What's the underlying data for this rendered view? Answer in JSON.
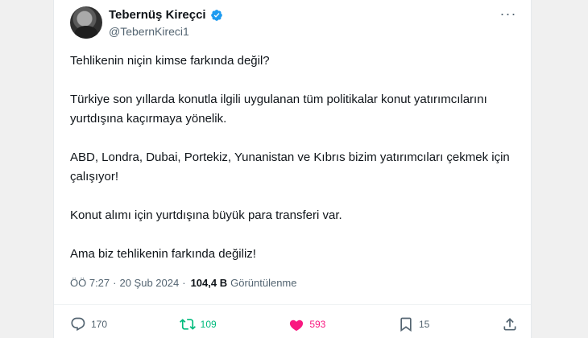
{
  "author": {
    "name": "Tebernüş Kireçci",
    "handle": "@TebernKireci1",
    "verified_color": "#1d9bf0"
  },
  "tweet": {
    "paragraphs": [
      "Tehlikenin niçin kimse farkında değil?",
      "Türkiye son yıllarda konutla ilgili uygulanan tüm politikalar konut yatırımcılarını yurtdışına kaçırmaya yönelik.",
      "ABD, Londra, Dubai, Portekiz, Yunanistan ve Kıbrıs bizim yatırımcıları çekmek için çalışıyor!",
      "Konut alımı için yurtdışına büyük para transferi var.",
      "Ama biz tehlikenin farkında değiliz!"
    ]
  },
  "meta": {
    "time": "ÖÖ 7:27",
    "separator": "·",
    "date": "20 Şub 2024",
    "views_count": "104,4 B",
    "views_label": "Görüntülenme"
  },
  "actions": {
    "replies": "170",
    "retweets": "109",
    "likes": "593",
    "bookmarks": "15"
  },
  "colors": {
    "retweet": "#00ba7c",
    "like": "#f91880",
    "secondary_text": "#536471"
  }
}
